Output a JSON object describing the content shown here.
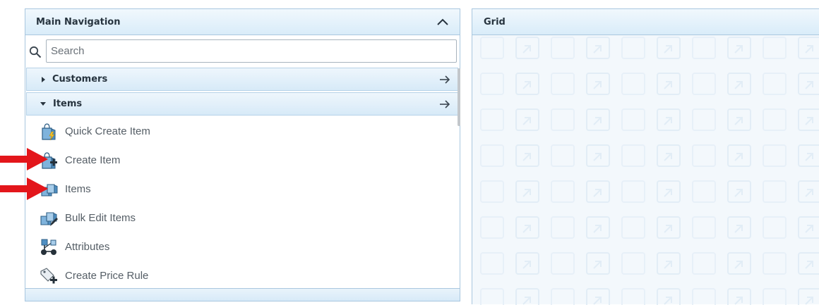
{
  "nav_panel": {
    "title": "Main Navigation",
    "collapse_icon": "chevron-up-icon",
    "search": {
      "placeholder": "Search",
      "value": "",
      "icon": "search-icon"
    },
    "groups": [
      {
        "label": "Customers",
        "expanded": false,
        "icon": "arrow-right-icon"
      },
      {
        "label": "Items",
        "expanded": true,
        "icon": "arrow-right-icon"
      }
    ],
    "items": [
      {
        "label": "Quick Create Item",
        "icon": "quick-create-item-icon"
      },
      {
        "label": "Create Item",
        "icon": "create-item-icon"
      },
      {
        "label": "Items",
        "icon": "items-icon"
      },
      {
        "label": "Bulk Edit Items",
        "icon": "bulk-edit-items-icon"
      },
      {
        "label": "Attributes",
        "icon": "attributes-icon"
      },
      {
        "label": "Create Price Rule",
        "icon": "create-price-rule-icon"
      }
    ]
  },
  "grid_panel": {
    "title": "Grid"
  },
  "annotations": {
    "arrow_color": "#e3161b",
    "arrows_point_to": [
      "Create Item",
      "Items"
    ]
  },
  "colors": {
    "header_bg": "#dbeefa",
    "border": "#a9c7df",
    "text": "#27343f"
  }
}
